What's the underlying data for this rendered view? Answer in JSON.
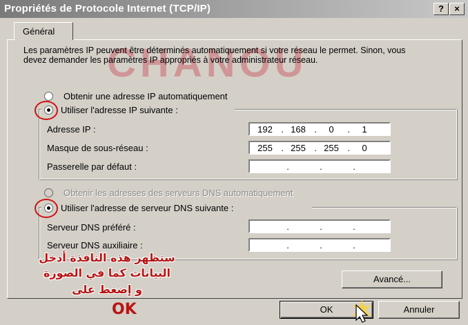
{
  "window": {
    "title": "Propriétés de Protocole Internet (TCP/IP)",
    "help_button": "?",
    "close_button": "×"
  },
  "tabs": [
    {
      "label": "Général"
    }
  ],
  "watermark": "CHANOU",
  "intro": "Les paramètres IP peuvent être déterminés automatiquement si votre réseau le permet. Sinon, vous devez demander les paramètres IP appropriés à votre administrateur réseau.",
  "ip": {
    "auto_label": "Obtenir une adresse IP automatiquement",
    "manual_label": "Utiliser l'adresse IP suivante :",
    "selected": "manual",
    "fields": [
      {
        "label": "Adresse IP :",
        "octets": [
          "192",
          "168",
          "0",
          "1"
        ]
      },
      {
        "label": "Masque de sous-réseau :",
        "octets": [
          "255",
          "255",
          "255",
          "0"
        ]
      },
      {
        "label": "Passerelle par défaut :",
        "octets": [
          "",
          "",
          "",
          ""
        ]
      }
    ]
  },
  "dns": {
    "auto_label": "Obtenir les adresses des serveurs DNS automatiquement",
    "manual_label": "Utiliser l'adresse de serveur DNS suivante :",
    "selected": "manual",
    "fields": [
      {
        "label": "Serveur DNS préféré :",
        "octets": [
          "",
          "",
          "",
          ""
        ]
      },
      {
        "label": "Serveur DNS auxiliaire :",
        "octets": [
          "",
          "",
          "",
          ""
        ]
      }
    ]
  },
  "buttons": {
    "advanced": "Avancé...",
    "ok": "OK",
    "cancel": "Annuler"
  },
  "annotation": {
    "line1": "ستظهر هذه النافذة أدخل",
    "line2": "البيانات كما في الصورة",
    "line3": "و إضغط على",
    "ok": "OK",
    "color": "#b81414"
  }
}
